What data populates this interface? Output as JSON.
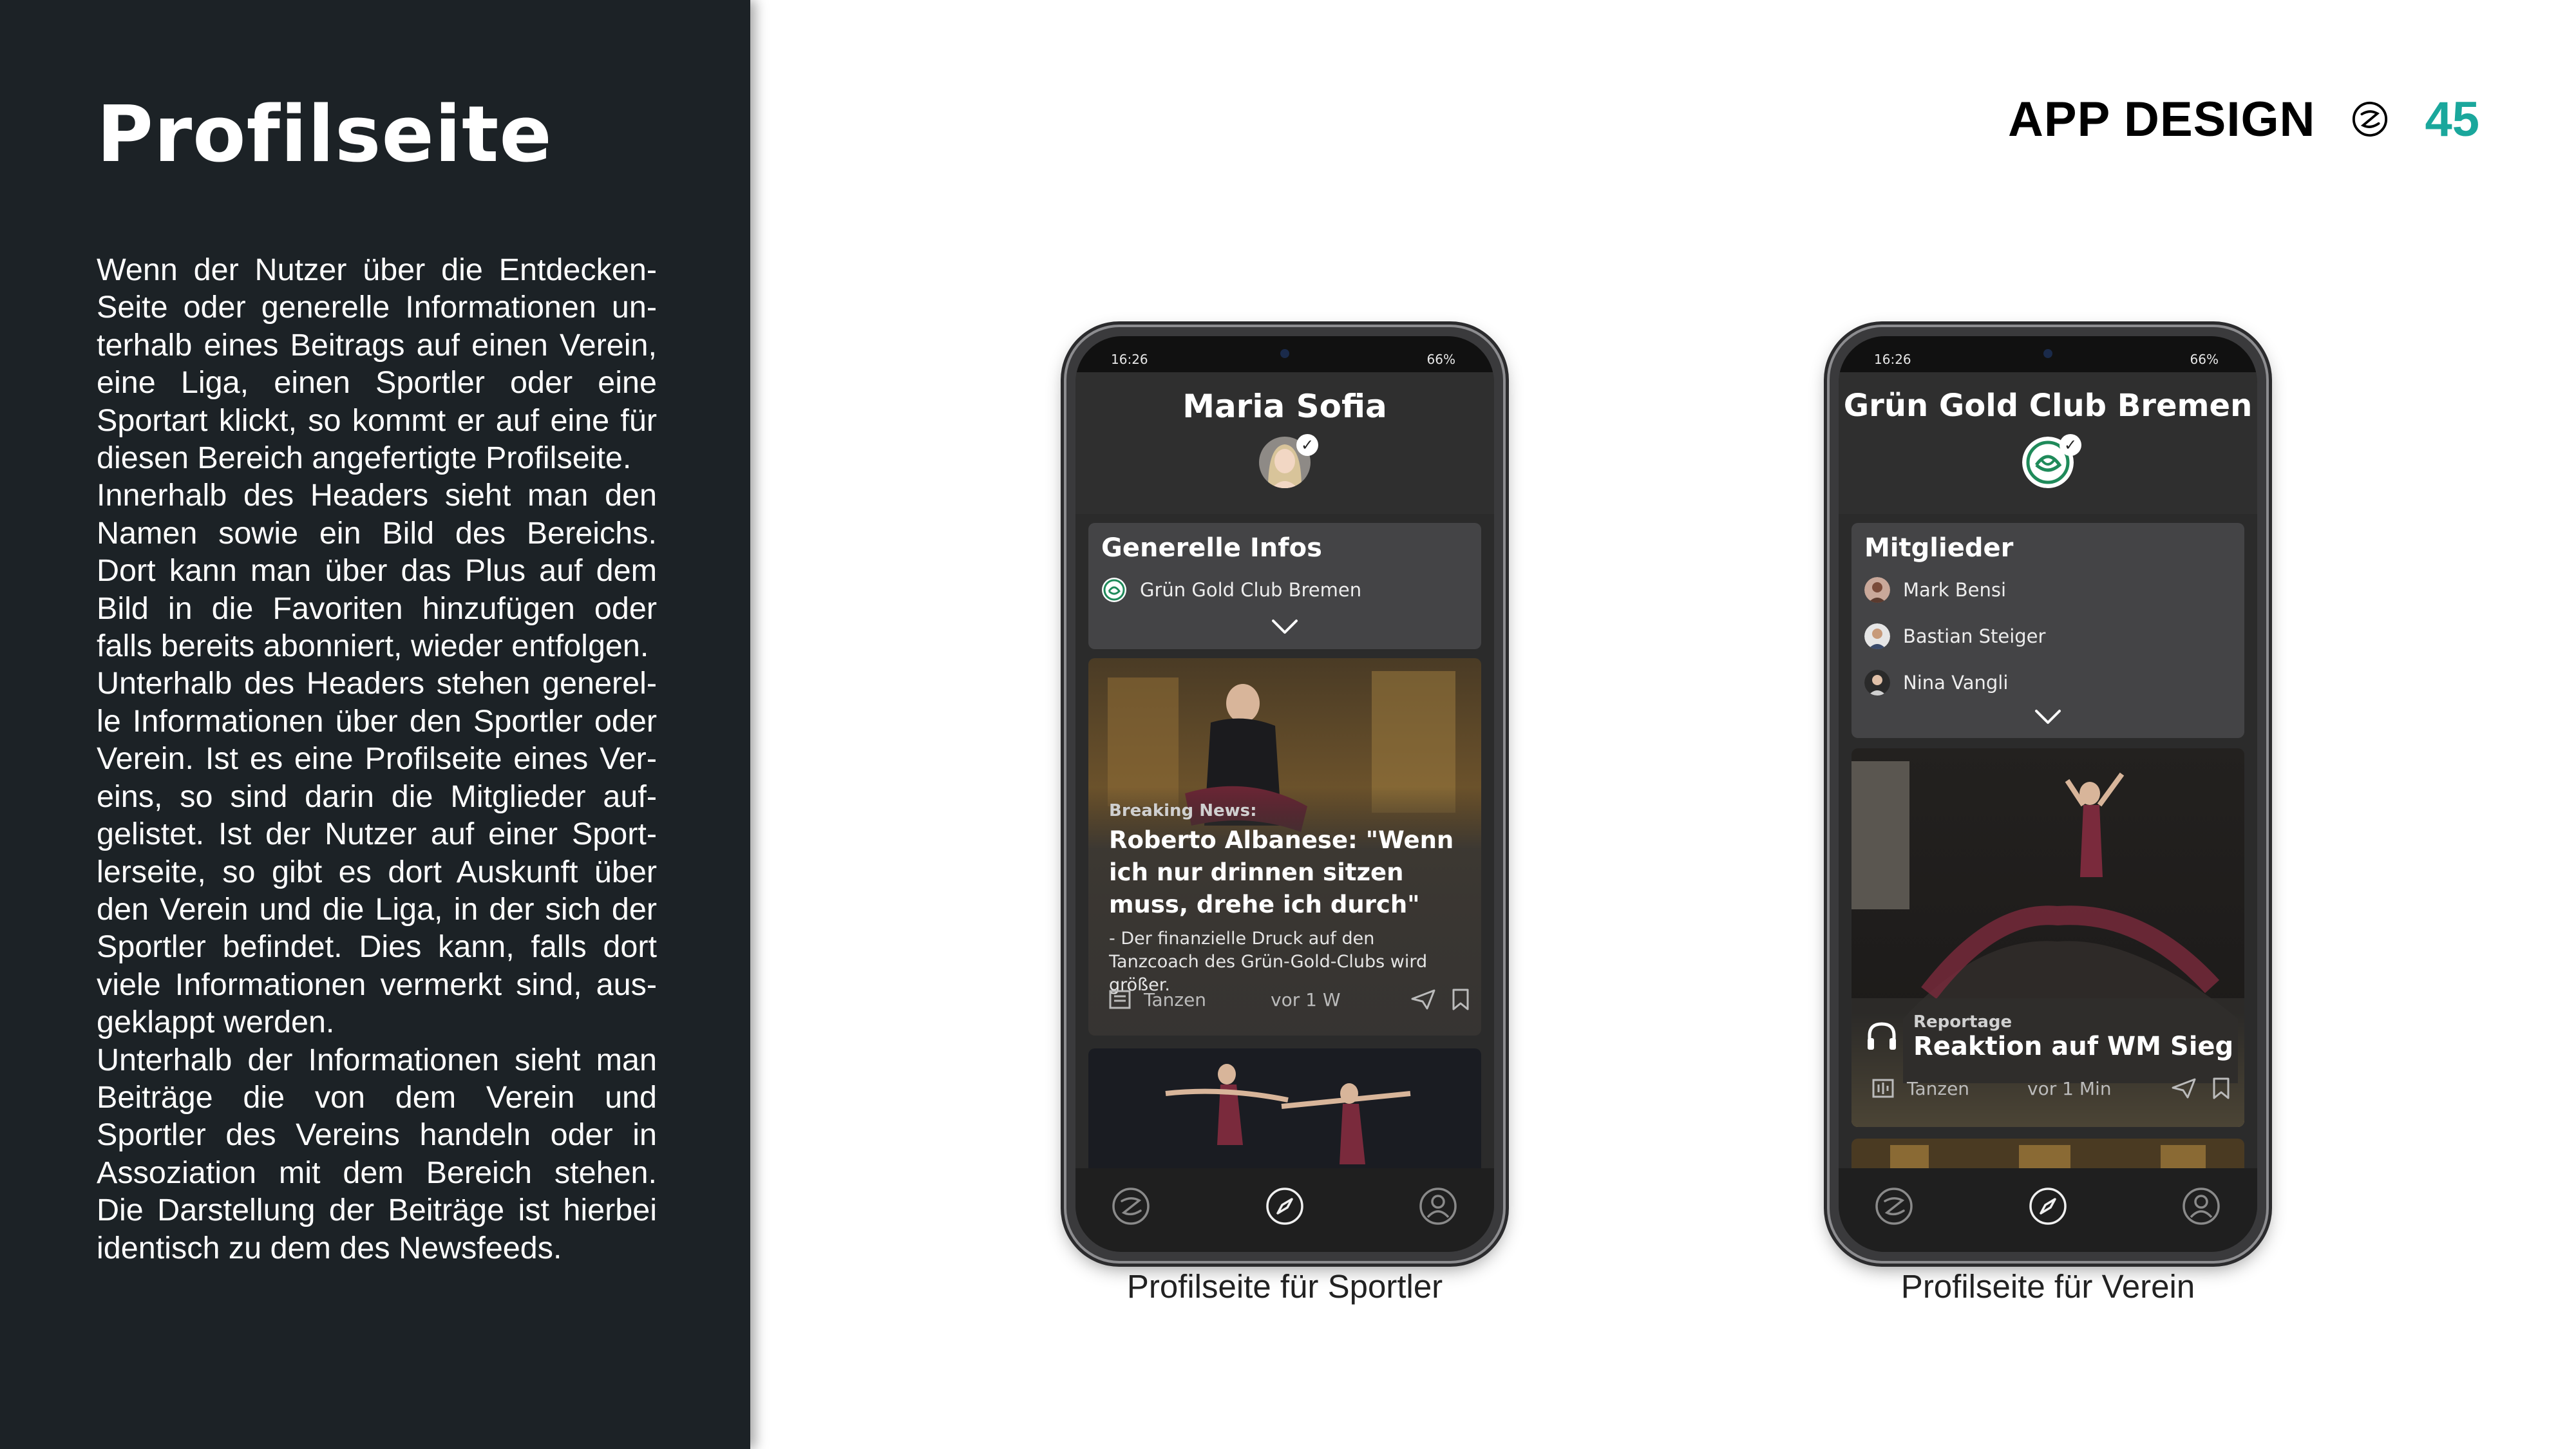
{
  "left_panel": {
    "title": "Profilseite",
    "paragraphs": [
      "Wenn der Nutzer über die Entdecken-Seite oder generelle Informationen un­ter­halb eines Beitrags auf einen Ver­ein, eine Liga, einen Sportler oder eine Sportart klickt, so kommt er auf eine für diesen Bereich angefertigte Profil­seite.",
      "Innerhalb des Headers sieht man den Namen sowie ein Bild des Bereichs. Dort kann man über das Plus auf dem Bild in die Favoriten hinzufügen oder falls bereits abonniert, wieder entfol­gen.",
      "Unterhalb des Headers stehen generel­le Informationen über den Sportler oder Verein. Ist es eine Profilseite eines Ver­eins, so sind darin die Mitglieder auf­gelistet. Ist der Nutzer auf einer Sport­lerseite, so gibt es dort Auskunft über den Verein und die Liga, in der sich der Sportler befindet. Dies kann, falls dort viele Informationen vermerkt sind, aus­geklappt werden.",
      "Unterhalb der Informationen sieht man Beiträge die von dem Verein und Sportler des Vereins handeln oder in Assoziation mit dem Bereich stehen. Die Darstellung der Beiträge ist hierbei identisch zu dem des Newsfeeds."
    ]
  },
  "header": {
    "section": "APP DESIGN",
    "page_number": "45",
    "logo_icon": "z-logo-icon",
    "accent": "#1aa79c"
  },
  "phones": [
    {
      "caption": "Profilseite für Sportler",
      "status": {
        "time": "16:26",
        "battery": "66%"
      },
      "profile_name": "Maria Sofia",
      "card": {
        "title": "Generelle Infos",
        "rows": [
          {
            "label": "Grün Gold Club Bremen",
            "icon": "club-logo-icon"
          }
        ]
      },
      "post": {
        "kicker": "Breaking News:",
        "headline": "Roberto Albanese: \"Wenn ich nur drinnen sitzen muss, drehe ich durch\"",
        "subline": "- Der finanzielle Druck auf den Tanzcoach des Grün-Gold-Clubs wird größer.",
        "category": "Tanzen",
        "time": "vor 1 W"
      }
    },
    {
      "caption": "Profilseite für Verein",
      "status": {
        "time": "16:26",
        "battery": "66%"
      },
      "profile_name": "Grün Gold Club Bremen",
      "card": {
        "title": "Mitglieder",
        "rows": [
          {
            "label": "Mark Bensi",
            "icon": "member-avatar-icon"
          },
          {
            "label": "Bastian Steiger",
            "icon": "member-avatar-icon"
          },
          {
            "label": "Nina Vangli",
            "icon": "member-avatar-icon"
          }
        ]
      },
      "post": {
        "kicker": "Reportage",
        "headline": "Reaktion auf WM Sieg",
        "category": "Tanzen",
        "time": "vor 1 Min"
      }
    }
  ]
}
